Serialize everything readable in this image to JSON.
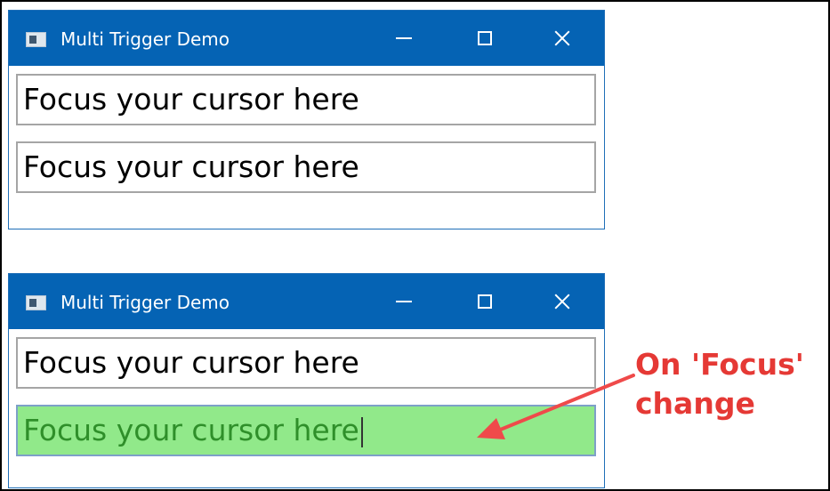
{
  "windows": [
    {
      "title": "Multi Trigger Demo",
      "textboxes": [
        {
          "text": "Focus your cursor here",
          "focused": false
        },
        {
          "text": "Focus your cursor here",
          "focused": false
        }
      ]
    },
    {
      "title": "Multi Trigger Demo",
      "textboxes": [
        {
          "text": "Focus your cursor here",
          "focused": false
        },
        {
          "text": "Focus your cursor here",
          "focused": true
        }
      ]
    }
  ],
  "annotation": {
    "line1": "On 'Focus'",
    "line2": "change"
  },
  "colors": {
    "titlebar": "#0563b4",
    "focused_background": "#91e98a",
    "focused_text": "#2f8f2a",
    "annotation": "#e53935"
  },
  "icons": [
    "app-window-icon",
    "minimize-icon",
    "maximize-icon",
    "close-icon",
    "annotation-arrow-icon"
  ]
}
